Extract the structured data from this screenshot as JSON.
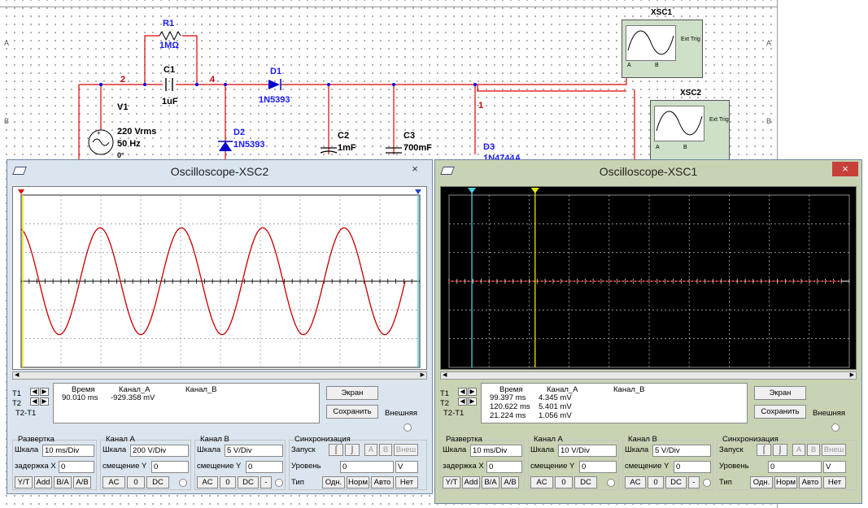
{
  "circuit": {
    "net_labels": {
      "n2": "2",
      "n4": "4",
      "n1": "1"
    },
    "components": {
      "r1": {
        "ref": "R1",
        "value": "1MΩ"
      },
      "c1": {
        "ref": "C1",
        "value": "1uF"
      },
      "d1": {
        "ref": "D1",
        "value": "1N5393"
      },
      "d2": {
        "ref": "D2",
        "value": "1N5393"
      },
      "v1": {
        "ref": "V1",
        "value1": "220 Vrms",
        "value2": "50 Hz",
        "value3": "0°"
      },
      "c2": {
        "ref": "C2",
        "value": "1mF"
      },
      "c3": {
        "ref": "C3",
        "value": "700mF"
      },
      "d3": {
        "ref": "D3",
        "value": "1N4744A"
      }
    },
    "instruments": {
      "xsc1": {
        "ref": "XSC1",
        "ext_trig": "Ext Trig",
        "a": "A",
        "b": "B"
      },
      "xsc2": {
        "ref": "XSC2",
        "ext_trig": "Ext Trig",
        "a": "A",
        "b": "B"
      }
    },
    "border_labels": {
      "a": "A",
      "b": "B"
    }
  },
  "windows": [
    {
      "title": "Oscilloscope-XSC2",
      "close": "×",
      "screen": "white",
      "readout": {
        "headers": {
          "time": "Время",
          "cha": "Канал_A",
          "chb": "Канал_B"
        },
        "rows": [
          {
            "label": "T1",
            "time": "90.010 ms",
            "cha": "-929.358 mV",
            "chb": ""
          },
          {
            "label": "T2",
            "time": "",
            "cha": "",
            "chb": ""
          },
          {
            "label": "T2-T1",
            "time": "",
            "cha": "",
            "chb": ""
          }
        ]
      },
      "btn_screen": "Экран",
      "btn_save": "Сохранить",
      "external": "Внешняя",
      "timebase": {
        "title": "Развертка",
        "scale_label": "Шкала",
        "scale": "10 ms/Div",
        "delay_label": "задержка X",
        "delay": "0",
        "yt": "Y/T",
        "add": "Add",
        "ba": "B/A",
        "ab": "A/B"
      },
      "cha": {
        "title": "Канал A",
        "scale_label": "Шкала",
        "scale": "200  V/Div",
        "offset_label": "смещение Y",
        "offset": "0",
        "ac": "AC",
        "zero": "0",
        "dc": "DC"
      },
      "chb": {
        "title": "Канал B",
        "scale_label": "Шкала",
        "scale": "5  V/Div",
        "offset_label": "смещение Y",
        "offset": "0",
        "ac": "AC",
        "zero": "0",
        "dc": "DC",
        "minus": "-"
      },
      "trigger": {
        "title": "Синхронизация",
        "start_label": "Запуск",
        "a": "A",
        "b": "B",
        "ext": "Внеш",
        "level_label": "Уровень",
        "level": "0",
        "unit": "V",
        "type_label": "Тип",
        "single": "Одн.",
        "normal": "Норм",
        "auto": "Авто",
        "none": "Нет"
      }
    },
    {
      "title": "Oscilloscope-XSC1",
      "close": "×",
      "screen": "black",
      "readout": {
        "headers": {
          "time": "Время",
          "cha": "Канал_A",
          "chb": "Канал_B"
        },
        "rows": [
          {
            "label": "T1",
            "time": "99.397 ms",
            "cha": "4.345 mV",
            "chb": ""
          },
          {
            "label": "T2",
            "time": "120.622 ms",
            "cha": "5.401 mV",
            "chb": ""
          },
          {
            "label": "T2-T1",
            "time": "21.224 ms",
            "cha": "1.056 mV",
            "chb": ""
          }
        ]
      },
      "btn_screen": "Экран",
      "btn_save": "Сохранить",
      "external": "Внешняя",
      "timebase": {
        "title": "Развертка",
        "scale_label": "Шкала",
        "scale": "10 ms/Div",
        "delay_label": "задержка X",
        "delay": "0",
        "yt": "Y/T",
        "add": "Add",
        "ba": "B/A",
        "ab": "A/B"
      },
      "cha": {
        "title": "Канал A",
        "scale_label": "Шкала",
        "scale": "10  V/Div",
        "offset_label": "смещение Y",
        "offset": "0",
        "ac": "AC",
        "zero": "0",
        "dc": "DC"
      },
      "chb": {
        "title": "Канал B",
        "scale_label": "Шкала",
        "scale": "5  V/Div",
        "offset_label": "смещение Y",
        "offset": "0",
        "ac": "AC",
        "zero": "0",
        "dc": "DC",
        "minus": "-"
      },
      "trigger": {
        "title": "Синхронизация",
        "start_label": "Запуск",
        "a": "A",
        "b": "B",
        "ext": "Внеш",
        "level_label": "Уровень",
        "level": "0",
        "unit": "V",
        "type_label": "Тип",
        "single": "Одн.",
        "normal": "Норм",
        "auto": "Авто",
        "none": "Нет"
      }
    }
  ],
  "colors": {
    "trace": "#c80000",
    "cursor1": "#4fd0e0",
    "cursor2": "#e8e800",
    "xsc1_frame": "#c8d3b4",
    "xsc2_frame": "#dbe5ef"
  }
}
